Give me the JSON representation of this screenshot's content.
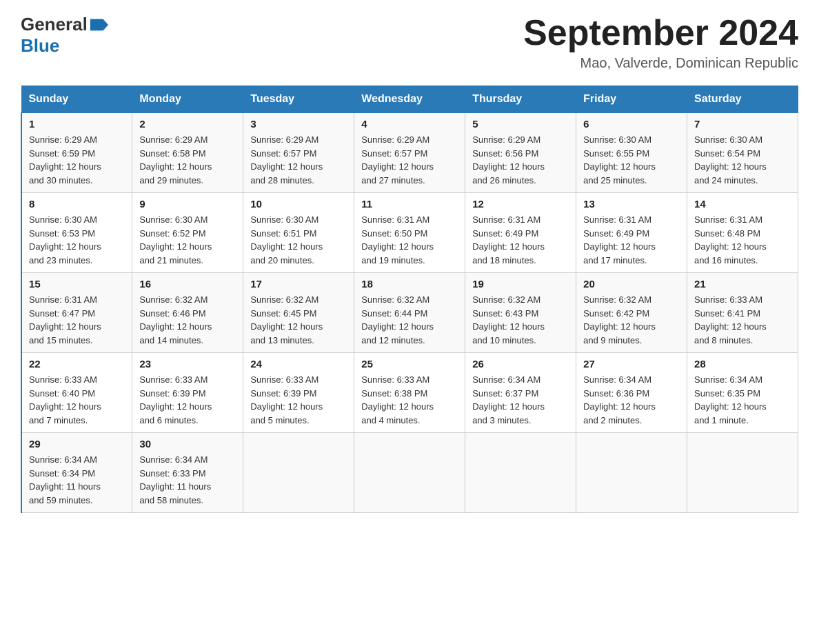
{
  "logo": {
    "text_general": "General",
    "text_blue": "Blue",
    "alt": "GeneralBlue logo"
  },
  "title": {
    "month_year": "September 2024",
    "location": "Mao, Valverde, Dominican Republic"
  },
  "days_of_week": [
    "Sunday",
    "Monday",
    "Tuesday",
    "Wednesday",
    "Thursday",
    "Friday",
    "Saturday"
  ],
  "weeks": [
    [
      {
        "num": "1",
        "sunrise": "6:29 AM",
        "sunset": "6:59 PM",
        "daylight": "12 hours and 30 minutes."
      },
      {
        "num": "2",
        "sunrise": "6:29 AM",
        "sunset": "6:58 PM",
        "daylight": "12 hours and 29 minutes."
      },
      {
        "num": "3",
        "sunrise": "6:29 AM",
        "sunset": "6:57 PM",
        "daylight": "12 hours and 28 minutes."
      },
      {
        "num": "4",
        "sunrise": "6:29 AM",
        "sunset": "6:57 PM",
        "daylight": "12 hours and 27 minutes."
      },
      {
        "num": "5",
        "sunrise": "6:29 AM",
        "sunset": "6:56 PM",
        "daylight": "12 hours and 26 minutes."
      },
      {
        "num": "6",
        "sunrise": "6:30 AM",
        "sunset": "6:55 PM",
        "daylight": "12 hours and 25 minutes."
      },
      {
        "num": "7",
        "sunrise": "6:30 AM",
        "sunset": "6:54 PM",
        "daylight": "12 hours and 24 minutes."
      }
    ],
    [
      {
        "num": "8",
        "sunrise": "6:30 AM",
        "sunset": "6:53 PM",
        "daylight": "12 hours and 23 minutes."
      },
      {
        "num": "9",
        "sunrise": "6:30 AM",
        "sunset": "6:52 PM",
        "daylight": "12 hours and 21 minutes."
      },
      {
        "num": "10",
        "sunrise": "6:30 AM",
        "sunset": "6:51 PM",
        "daylight": "12 hours and 20 minutes."
      },
      {
        "num": "11",
        "sunrise": "6:31 AM",
        "sunset": "6:50 PM",
        "daylight": "12 hours and 19 minutes."
      },
      {
        "num": "12",
        "sunrise": "6:31 AM",
        "sunset": "6:49 PM",
        "daylight": "12 hours and 18 minutes."
      },
      {
        "num": "13",
        "sunrise": "6:31 AM",
        "sunset": "6:49 PM",
        "daylight": "12 hours and 17 minutes."
      },
      {
        "num": "14",
        "sunrise": "6:31 AM",
        "sunset": "6:48 PM",
        "daylight": "12 hours and 16 minutes."
      }
    ],
    [
      {
        "num": "15",
        "sunrise": "6:31 AM",
        "sunset": "6:47 PM",
        "daylight": "12 hours and 15 minutes."
      },
      {
        "num": "16",
        "sunrise": "6:32 AM",
        "sunset": "6:46 PM",
        "daylight": "12 hours and 14 minutes."
      },
      {
        "num": "17",
        "sunrise": "6:32 AM",
        "sunset": "6:45 PM",
        "daylight": "12 hours and 13 minutes."
      },
      {
        "num": "18",
        "sunrise": "6:32 AM",
        "sunset": "6:44 PM",
        "daylight": "12 hours and 12 minutes."
      },
      {
        "num": "19",
        "sunrise": "6:32 AM",
        "sunset": "6:43 PM",
        "daylight": "12 hours and 10 minutes."
      },
      {
        "num": "20",
        "sunrise": "6:32 AM",
        "sunset": "6:42 PM",
        "daylight": "12 hours and 9 minutes."
      },
      {
        "num": "21",
        "sunrise": "6:33 AM",
        "sunset": "6:41 PM",
        "daylight": "12 hours and 8 minutes."
      }
    ],
    [
      {
        "num": "22",
        "sunrise": "6:33 AM",
        "sunset": "6:40 PM",
        "daylight": "12 hours and 7 minutes."
      },
      {
        "num": "23",
        "sunrise": "6:33 AM",
        "sunset": "6:39 PM",
        "daylight": "12 hours and 6 minutes."
      },
      {
        "num": "24",
        "sunrise": "6:33 AM",
        "sunset": "6:39 PM",
        "daylight": "12 hours and 5 minutes."
      },
      {
        "num": "25",
        "sunrise": "6:33 AM",
        "sunset": "6:38 PM",
        "daylight": "12 hours and 4 minutes."
      },
      {
        "num": "26",
        "sunrise": "6:34 AM",
        "sunset": "6:37 PM",
        "daylight": "12 hours and 3 minutes."
      },
      {
        "num": "27",
        "sunrise": "6:34 AM",
        "sunset": "6:36 PM",
        "daylight": "12 hours and 2 minutes."
      },
      {
        "num": "28",
        "sunrise": "6:34 AM",
        "sunset": "6:35 PM",
        "daylight": "12 hours and 1 minute."
      }
    ],
    [
      {
        "num": "29",
        "sunrise": "6:34 AM",
        "sunset": "6:34 PM",
        "daylight": "11 hours and 59 minutes."
      },
      {
        "num": "30",
        "sunrise": "6:34 AM",
        "sunset": "6:33 PM",
        "daylight": "11 hours and 58 minutes."
      },
      null,
      null,
      null,
      null,
      null
    ]
  ],
  "labels": {
    "sunrise": "Sunrise:",
    "sunset": "Sunset:",
    "daylight": "Daylight:"
  }
}
